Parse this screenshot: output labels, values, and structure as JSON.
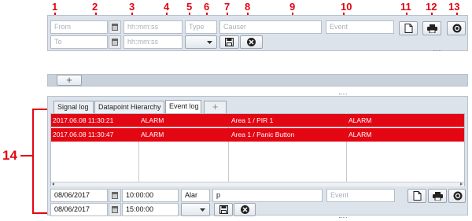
{
  "callouts": [
    "1",
    "2",
    "3",
    "4",
    "5",
    "6",
    "7",
    "8",
    "9",
    "10",
    "11",
    "12",
    "13",
    "14"
  ],
  "filter": {
    "from_placeholder": "From",
    "to_placeholder": "To",
    "time_placeholder": "hh:mm:ss",
    "type_placeholder": "Type",
    "causer_placeholder": "Causer",
    "event_placeholder": "Event"
  },
  "add_tab_label": "+",
  "tabs": [
    "Signal log",
    "Datapoint Hierarchy",
    "Event log",
    "+"
  ],
  "rows": [
    [
      "2017.06.08 11:30:21",
      "ALARM",
      "Area 1 / PIR 1",
      "ALARM"
    ],
    [
      "2017.06.08 11:30:47",
      "ALARM",
      "Area 1 / Panic Button",
      "ALARM"
    ]
  ],
  "bottom_filter": {
    "from_date": "08/06/2017",
    "from_time": "10:00:00",
    "to_date": "08/06/2017",
    "to_time": "15:00:00",
    "type_value": "Alar",
    "causer_value": "p",
    "event_placeholder": "Event"
  },
  "colors": {
    "callout": "#e30613",
    "selected_row": "#e30613",
    "panel": "#dde3ea"
  }
}
